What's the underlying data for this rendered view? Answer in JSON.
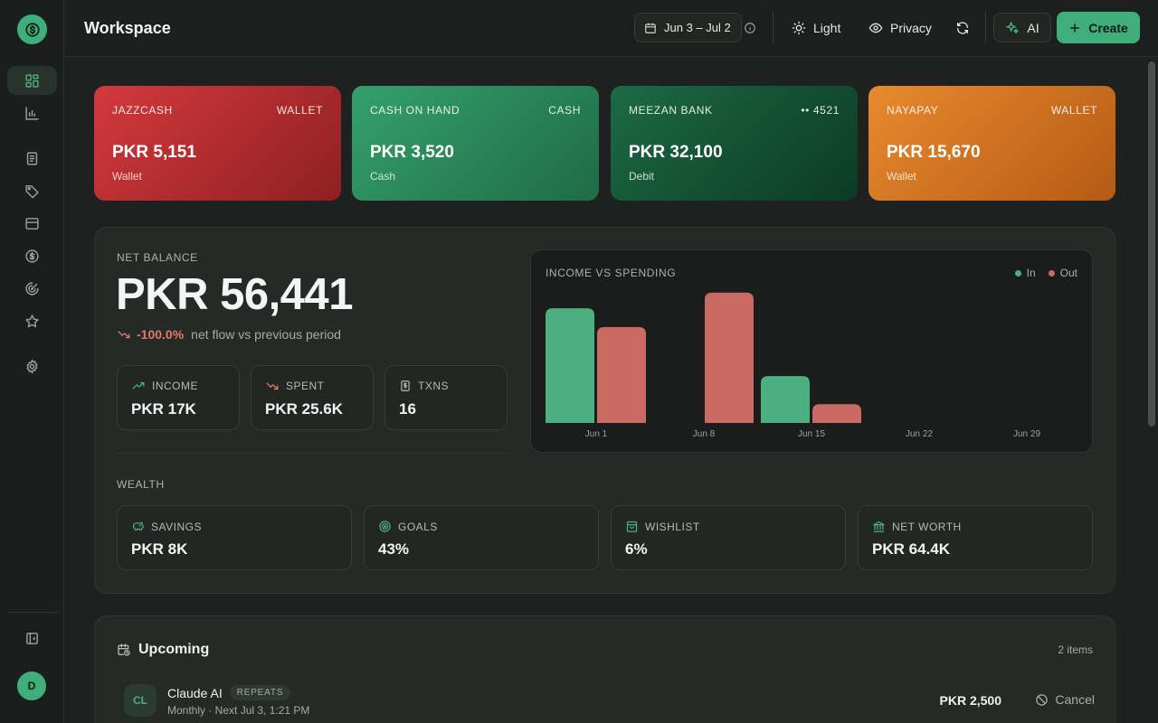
{
  "header": {
    "title": "Workspace",
    "date_range": "Jun 3 – Jul 2",
    "theme_label": "Light",
    "privacy_label": "Privacy",
    "ai_label": "AI",
    "create_label": "Create"
  },
  "sidebar": {
    "avatar_initial": "D",
    "items": [
      "dashboard",
      "analytics",
      "transactions",
      "categories",
      "inbox",
      "budgets",
      "goals",
      "wishlist",
      "settings"
    ]
  },
  "accounts": [
    {
      "name": "JAZZCASH",
      "tag": "WALLET",
      "amount": "PKR 5,151",
      "sub": "Wallet",
      "color": "#c8363a"
    },
    {
      "name": "CASH ON HAND",
      "tag": "CASH",
      "amount": "PKR 3,520",
      "sub": "Cash",
      "color": "#2f8d5e"
    },
    {
      "name": "MEEZAN BANK",
      "tag": "•• 4521",
      "amount": "PKR 32,100",
      "sub": "Debit",
      "color": "#17583b"
    },
    {
      "name": "NAYAPAY",
      "tag": "WALLET",
      "amount": "PKR 15,670",
      "sub": "Wallet",
      "color": "#d9761f"
    }
  ],
  "overview": {
    "net_label": "NET BALANCE",
    "net_value": "PKR 56,441",
    "change": "-100.0%",
    "change_text": "net flow vs previous period",
    "stats": [
      {
        "label": "INCOME",
        "value": "PKR 17K"
      },
      {
        "label": "SPENT",
        "value": "PKR 25.6K"
      },
      {
        "label": "TXNS",
        "value": "16"
      }
    ],
    "wealth_label": "WEALTH",
    "wealth": [
      {
        "label": "SAVINGS",
        "value": "PKR 8K"
      },
      {
        "label": "GOALS",
        "value": "43%"
      },
      {
        "label": "WISHLIST",
        "value": "6%"
      },
      {
        "label": "NET WORTH",
        "value": "PKR 64.4K"
      }
    ]
  },
  "chart_data": {
    "type": "bar",
    "title": "INCOME VS SPENDING",
    "categories": [
      "Jun 1",
      "Jun 8",
      "Jun 15",
      "Jun 22",
      "Jun 29"
    ],
    "series": [
      {
        "name": "In",
        "values": [
          11,
          0,
          4.5,
          0,
          0
        ],
        "color": "#4caf80"
      },
      {
        "name": "Out",
        "values": [
          9.2,
          12.5,
          1.8,
          0,
          0
        ],
        "color": "#c96b63"
      }
    ],
    "ylim": [
      0,
      13
    ],
    "legend": "top-right"
  },
  "upcoming": {
    "title": "Upcoming",
    "count": "2 items",
    "items": [
      {
        "initials": "CL",
        "name": "Claude AI",
        "badge": "REPEATS",
        "meta": "Monthly · Next Jul 3, 1:21 PM",
        "amount": "PKR 2,500",
        "action": "Cancel"
      }
    ]
  }
}
